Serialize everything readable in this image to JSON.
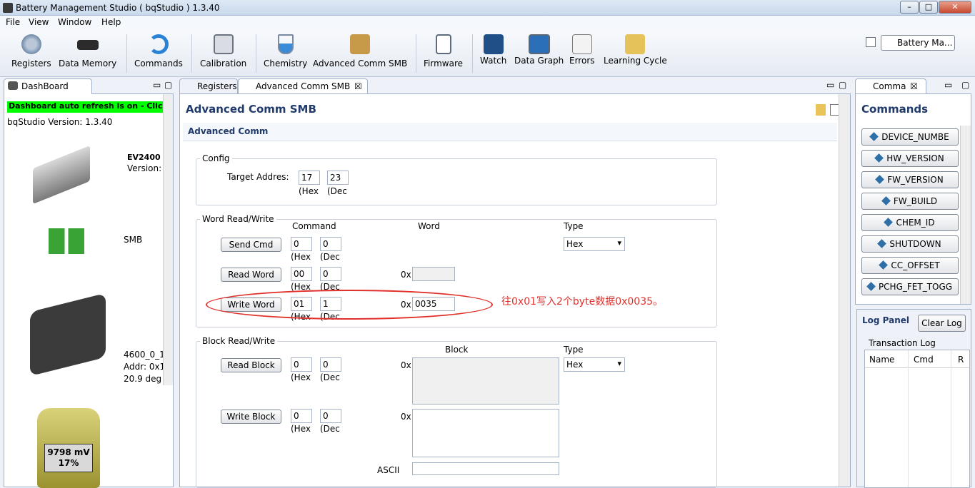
{
  "window": {
    "title": "Battery Management Studio ( bqStudio ) 1.3.40"
  },
  "menu": [
    "File",
    "View",
    "Window",
    "Help"
  ],
  "toolbar": {
    "items": [
      "Registers",
      "Data Memory",
      "Commands",
      "Calibration",
      "Chemistry",
      "Advanced Comm SMB",
      "Firmware",
      "Watch",
      "Data Graph",
      "Errors",
      "Learning Cycle"
    ],
    "perspective": "Battery Ma..."
  },
  "dashboard": {
    "tab": "DashBoard",
    "refresh_banner": "Dashboard auto refresh is on - Click to",
    "version": "bqStudio Version:  1.3.40",
    "device": "EV2400",
    "device_version": "Version:",
    "bus": "SMB",
    "chip1": "4600_0_1",
    "chip2": "Addr: 0x1",
    "chip3": "20.9 deg",
    "battery_mv": "9798 mV",
    "battery_pct": "17%"
  },
  "tabs": {
    "registers": "Registers",
    "advanced": "Advanced Comm SMB"
  },
  "adv": {
    "title": "Advanced Comm SMB",
    "section": "Advanced Comm",
    "config": {
      "label": "Config",
      "target_label": "Target Addres:",
      "hex_value": "17",
      "dec_value": "23",
      "hex_unit": "(Hex",
      "dec_unit": "(Dec"
    },
    "word": {
      "label": "Word Read/Write",
      "col_command": "Command",
      "col_word": "Word",
      "col_type": "Type",
      "type_value": "Hex",
      "prefix": "0x",
      "send_cmd": "Send Cmd",
      "send_hex": "0",
      "send_dec": "0",
      "read_word": "Read Word",
      "read_hex": "00",
      "read_dec": "0",
      "write_word": "Write Word",
      "write_hex": "01",
      "write_dec": "1",
      "write_value": "0035",
      "hex_unit": "(Hex",
      "dec_unit": "(Dec"
    },
    "block": {
      "label": "Block Read/Write",
      "col_block": "Block",
      "col_type": "Type",
      "type_value": "Hex",
      "prefix": "0x",
      "read_block": "Read Block",
      "read_hex": "0",
      "read_dec": "0",
      "write_block": "Write Block",
      "write_hex": "0",
      "write_dec": "0",
      "ascii": "ASCII",
      "hex_unit": "(Hex",
      "dec_unit": "(Dec"
    },
    "annotation": "往0x01写入2个byte数据0x0035。"
  },
  "commands": {
    "tab": "Comma",
    "title": "Commands",
    "items": [
      "DEVICE_NUMBE",
      "HW_VERSION",
      "FW_VERSION",
      "FW_BUILD",
      "CHEM_ID",
      "SHUTDOWN",
      "CC_OFFSET",
      "PCHG_FET_TOGG"
    ]
  },
  "log": {
    "title": "Log Panel",
    "clear": "Clear Log",
    "transaction": "Transaction Log",
    "cols": [
      "Name",
      "Cmd",
      "R"
    ]
  },
  "colors": {
    "accent": "#1f3a6b",
    "banner": "#00ff00",
    "annotation": "#e0302a"
  }
}
